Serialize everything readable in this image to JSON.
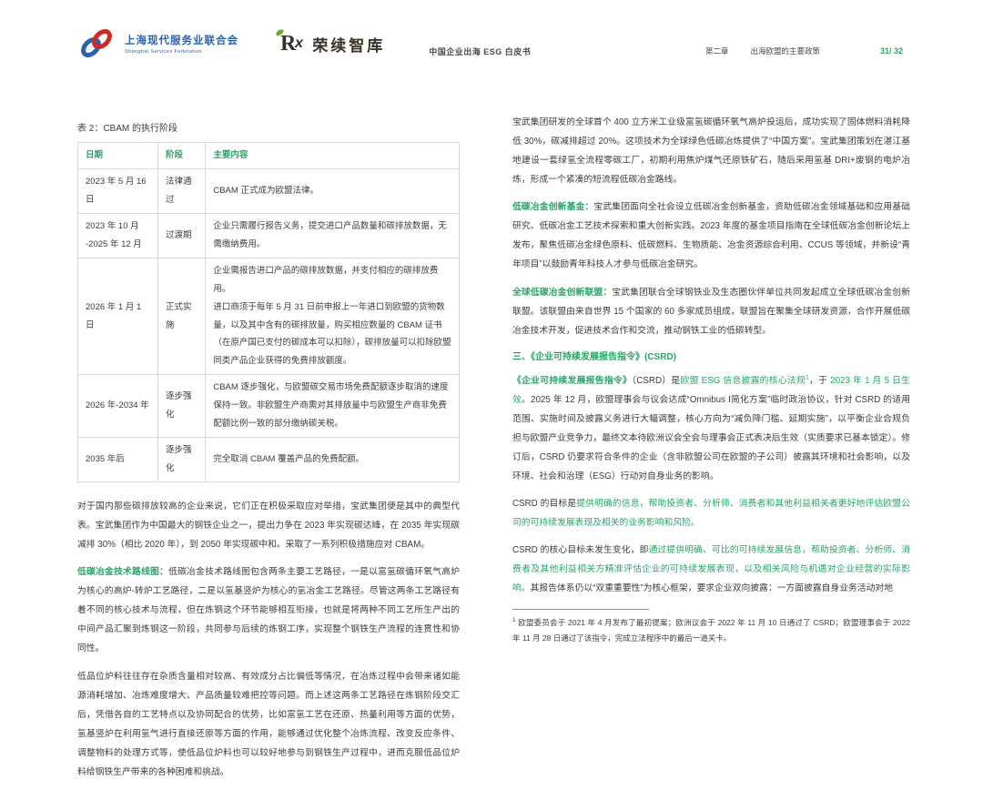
{
  "colors": {
    "accent_green": "#27a567",
    "logo_blue": "#2a63ad",
    "logo_red": "#cc2a26",
    "table_border": "#d9d9d9"
  },
  "header": {
    "federation_logo": {
      "title": "上海现代服务业联合会",
      "subtitle": "Shanghai Services Federation"
    },
    "thinktank_logo": {
      "mark_r": "R",
      "mark_x": "x",
      "name": "荣续智库"
    },
    "doc_title": "中国企业出海 ESG 白皮书",
    "chapter_label": "第二章",
    "chapter_title": "出海欧盟的主要政策",
    "page_number": "31/ 32"
  },
  "left": {
    "table_caption": "表 2：CBAM 的执行阶段",
    "table": {
      "headers": [
        "日期",
        "阶段",
        "主要内容"
      ],
      "rows": [
        [
          "2023 年 5 月 16 日",
          "法律通过",
          "CBAM 正式成为欧盟法律。"
        ],
        [
          "2023 年 10 月\n-2025 年 12 月",
          "过渡期",
          "企业只需履行报告义务，提交进口产品数量和碳排放数据，无需缴纳费用。"
        ],
        [
          "2026 年 1 月 1 日",
          "正式实施",
          "企业需报告进口产品的碳排放数据，并支付相应的碳排放费用。\n进口商须于每年 5 月 31 日前申报上一年进口到欧盟的货物数量，以及其中含有的碳排放量，购买相应数量的 CBAM 证书（在原产国已支付的碳成本可以扣除），碳排放量可以扣除欧盟同类产品企业获得的免费排放额度。"
        ],
        [
          "2026 年-2034 年",
          "逐步强化",
          "CBAM 逐步强化，与欧盟碳交易市场免费配额逐步取消的速度保持一致。非欧盟生产商需对其排放量中与欧盟生产商非免费配额比例一致的部分缴纳碳关税。"
        ],
        [
          "2035 年后",
          "逐步强化",
          "完全取消 CBAM 覆盖产品的免费配额。"
        ]
      ]
    },
    "paragraphs": [
      {
        "segments": [
          {
            "t": "对于国内那些碳排放较高的企业来说，它们正在积极采取应对举措，宝武集团便是其中的典型代表。宝武集团作为中国最大的钢铁企业之一，提出力争在 2023 年实现碳达峰，在 2035 年实现碳减排 30%（相比 2020 年），到 2050 年实现碳中和。采取了一系列积极措施应对 CBAM。",
            "s": "n"
          }
        ]
      },
      {
        "segments": [
          {
            "t": "低碳冶金技术路线图：",
            "s": "gb"
          },
          {
            "t": "低碳冶金技术路线图包含两条主要工艺路径，一是以富氢碳循环氧气高炉为核心的高炉-转炉工艺路径，二是以氢基竖炉为核心的氢冶金工艺路径。尽管这两条工艺路径有着不同的核心技术与流程，但在炼钢这个环节能够相互衔接，也就是将两种不同工艺所生产出的中间产品汇聚到炼钢这一阶段，共同参与后续的炼钢工序，实现整个钢铁生产流程的连贯性和协同性。",
            "s": "n"
          }
        ]
      },
      {
        "segments": [
          {
            "t": "低品位炉料往往存在杂质含量相对较高、有效成分占比偏低等情况，在冶炼过程中会带来诸如能源消耗增加、冶炼难度增大、产品质量较难把控等问题。而上述这两条工艺路径在炼钢阶段交汇后，凭借各自的工艺特点以及协同配合的优势，比如富氢工艺在还原、热量利用等方面的优势，氢基竖炉在利用氢气进行直接还原等方面的作用，能够通过优化整个冶炼流程、改变反应条件、调整物料的处理方式等，使低品位炉料也可以较好地参与到钢铁生产过程中，进而克服低品位炉料给钢铁生产带来的各种困难和挑战。",
            "s": "n"
          }
        ]
      }
    ]
  },
  "right": {
    "paragraphs_top": [
      {
        "segments": [
          {
            "t": "宝武集团研发的全球首个 400 立方米工业级富氢碳循环氧气高炉投运后，成功实现了固体燃料消耗降低 30%，碳减排超过 20%。这项技术为全球绿色低碳冶炼提供了“中国方案”。宝武集团策划在湛江基地建设一套绿氢全流程零碳工厂，初期利用焦炉煤气还原铁矿石，随后采用氢基 DRI+废钢的电炉冶炼，形成一个紧凑的短流程低碳冶金路线。",
            "s": "n"
          }
        ]
      },
      {
        "segments": [
          {
            "t": "低碳冶金创新基金：",
            "s": "gb"
          },
          {
            "t": "宝武集团面向全社会设立低碳冶金创新基金，资助低碳冶金领域基础和应用基础研究、低碳冶金工艺技术探索和重大创新实践。2023 年度的基金项目指南在全球低碳冶金创新论坛上发布，聚焦低碳冶金绿色原料、低碳燃料、生物质能、冶金资源综合利用、CCUS 等领域，并新设“青年项目”以鼓励青年科技人才参与低碳冶金研究。",
            "s": "n"
          }
        ]
      },
      {
        "segments": [
          {
            "t": "全球低碳冶金创新联盟：",
            "s": "gb"
          },
          {
            "t": "宝武集团联合全球钢铁业及生态圈伙伴单位共同发起成立全球低碳冶金创新联盟。该联盟由来自世界 15 个国家的 60 多家成员组成，联盟旨在聚集全球研发资源，合作开展低碳冶金技术开发，促进技术合作和交流，推动钢铁工业的低碳转型。",
            "s": "n"
          }
        ]
      }
    ],
    "section_heading": "三、《企业可持续发展报告指令》(CSRD)",
    "paragraphs_bottom": [
      {
        "segments": [
          {
            "t": "《企业可持续发展报告指令》",
            "s": "gb"
          },
          {
            "t": "（CSRD）是",
            "s": "n"
          },
          {
            "t": "欧盟 ESG 信息披露的核心法规",
            "s": "g"
          },
          {
            "t": "1",
            "s": "gsup"
          },
          {
            "t": "，于 ",
            "s": "n"
          },
          {
            "t": "2023 年 1 月 5 日生效",
            "s": "g"
          },
          {
            "t": "。2025 年 12 月，欧盟理事会与议会达成“Omnibus Ⅰ简化方案”临时政治协议，针对 CSRD 的适用范围、实施时间及披露义务进行大幅调整，核心方向为“减负降门槛、延期实施”，以平衡企业合规负担与欧盟产业竞争力，最终文本待欧洲议会全会与理事会正式表决后生效（实质要求已基本锁定）。修订后，CSRD 仍要求符合条件的企业（含非欧盟公司在欧盟的子公司）披露其环境和社会影响，以及环境、社会和治理（ESG）行动对自身业务的影响。",
            "s": "n"
          }
        ]
      },
      {
        "segments": [
          {
            "t": "CSRD 的目标是",
            "s": "n"
          },
          {
            "t": "提供明确的信息，帮助投资者、分析师、消费者和其他利益相关者更好地评估欧盟公司的可持续发展表现及相关的业务影响和风险。",
            "s": "g"
          }
        ]
      },
      {
        "segments": [
          {
            "t": "CSRD 的核心目标未发生变化，即",
            "s": "n"
          },
          {
            "t": "通过提供明确、可比的可持续发展信息，帮助投资者、分析师、消费者及其他利益相关方精准评估企业的可持续发展表现，以及相关风险与机遇对企业经营的实际影响。",
            "s": "g"
          },
          {
            "t": "其报告体系仍以“双重重要性”为核心框架，要求企业双向披露：一方面披露自身业务活动对地",
            "s": "n"
          }
        ]
      }
    ],
    "footnote": {
      "segments": [
        {
          "t": "1",
          "s": "sup"
        },
        {
          "t": " 欧盟委员会于 2021 年 4 月发布了最初提案；欧洲议会于 2022 年 11 月 10 日通过了 CSRD；欧盟理事会于 2022 年 11 月 28 日通过了该指令，完成立法程序中的最后一道关卡。",
          "s": "n"
        }
      ]
    }
  }
}
